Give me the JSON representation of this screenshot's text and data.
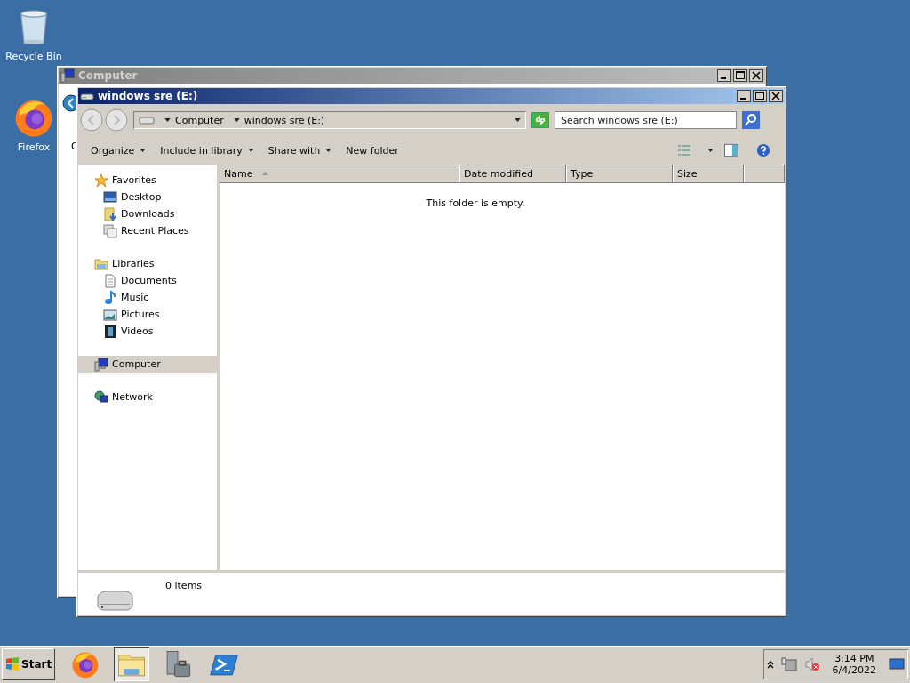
{
  "desktop_icons": [
    {
      "kind": "recycle",
      "label": "Recycle Bin"
    },
    {
      "kind": "firefox",
      "label": "Firefox"
    }
  ],
  "back_window": {
    "title": "Computer",
    "fragment": "C"
  },
  "window": {
    "title": "windows sre (E:)",
    "breadcrumb": [
      "Computer",
      "windows sre (E:)"
    ],
    "search": {
      "placeholder": "Search windows sre (E:)"
    },
    "toolbar": [
      {
        "label": "Organize",
        "menu": true
      },
      {
        "label": "Include in library",
        "menu": true
      },
      {
        "label": "Share with",
        "menu": true
      },
      {
        "label": "New folder",
        "menu": false
      }
    ],
    "nav": [
      {
        "kind": "star",
        "label": "Favorites",
        "selected": false,
        "children": [
          {
            "kind": "desktop",
            "label": "Desktop",
            "selected": false
          },
          {
            "kind": "downloads",
            "label": "Downloads",
            "selected": false
          },
          {
            "kind": "recent",
            "label": "Recent Places",
            "selected": false
          }
        ]
      },
      {
        "kind": "libraries",
        "label": "Libraries",
        "selected": false,
        "children": [
          {
            "kind": "documents",
            "label": "Documents",
            "selected": false
          },
          {
            "kind": "music",
            "label": "Music",
            "selected": false
          },
          {
            "kind": "pictures",
            "label": "Pictures",
            "selected": false
          },
          {
            "kind": "videos",
            "label": "Videos",
            "selected": false
          }
        ]
      },
      {
        "kind": "computer",
        "label": "Computer",
        "selected": true
      },
      {
        "kind": "network",
        "label": "Network",
        "selected": false
      }
    ],
    "columns": [
      {
        "label": "Name",
        "sorted": true
      },
      {
        "label": "Date modified",
        "sorted": false
      },
      {
        "label": "Type",
        "sorted": false
      },
      {
        "label": "Size",
        "sorted": false
      }
    ],
    "empty_message": "This folder is empty.",
    "status": "0 items"
  },
  "taskbar": {
    "start": "Start",
    "items": [
      {
        "kind": "firefox",
        "selected": false
      },
      {
        "kind": "explorer",
        "selected": true
      },
      {
        "kind": "server",
        "selected": false
      },
      {
        "kind": "powershell",
        "selected": false
      }
    ],
    "time": "3:14 PM",
    "date": "6/4/2022"
  }
}
